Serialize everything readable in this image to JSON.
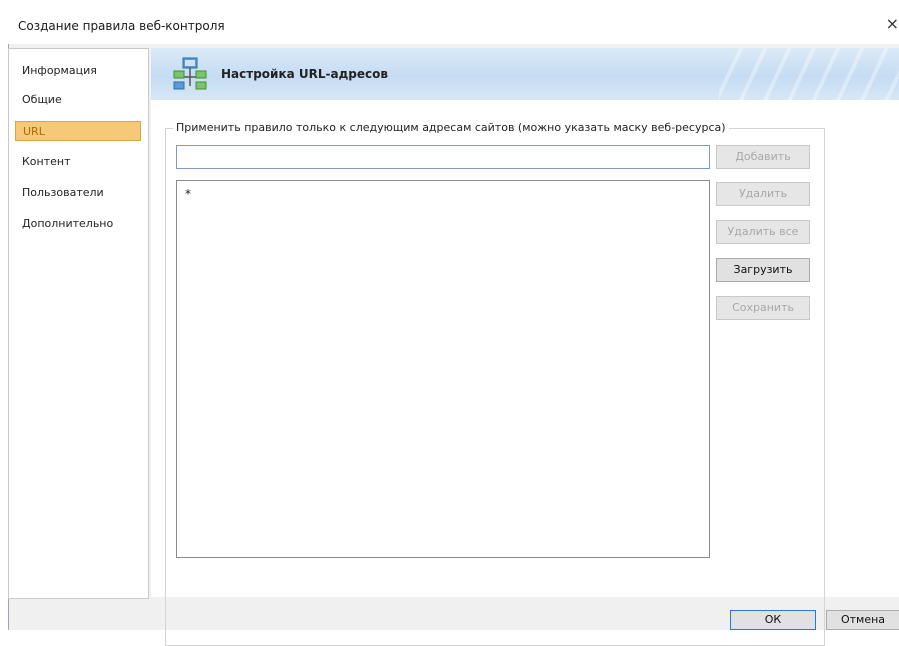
{
  "window": {
    "title": "Создание правила веб-контроля",
    "close_glyph": "×"
  },
  "sidebar": {
    "items": [
      {
        "label": "Информация",
        "active": false
      },
      {
        "label": "Общие",
        "active": false
      },
      {
        "label": "URL",
        "active": true
      },
      {
        "label": "Контент",
        "active": false
      },
      {
        "label": "Пользователи",
        "active": false
      },
      {
        "label": "Дополнительно",
        "active": false
      }
    ]
  },
  "header": {
    "title": "Настройка URL-адресов",
    "icon": "url-settings-icon"
  },
  "group": {
    "legend": "Применить правило только к следующим адресам сайтов (можно указать маску веб-ресурса)"
  },
  "url_input": {
    "value": ""
  },
  "url_list": {
    "items": [
      "*"
    ]
  },
  "buttons": {
    "add": {
      "label": "Добавить",
      "enabled": false
    },
    "delete": {
      "label": "Удалить",
      "enabled": false
    },
    "delete_all": {
      "label": "Удалить все",
      "enabled": false
    },
    "load": {
      "label": "Загрузить",
      "enabled": true
    },
    "save": {
      "label": "Сохранить",
      "enabled": false
    }
  },
  "footer": {
    "ok_label": "ОК",
    "cancel_label": "Отмена"
  },
  "colors": {
    "active_nav": "#f5c87a",
    "banner": "#c5dcf3",
    "input_border": "#7a9cc6"
  }
}
